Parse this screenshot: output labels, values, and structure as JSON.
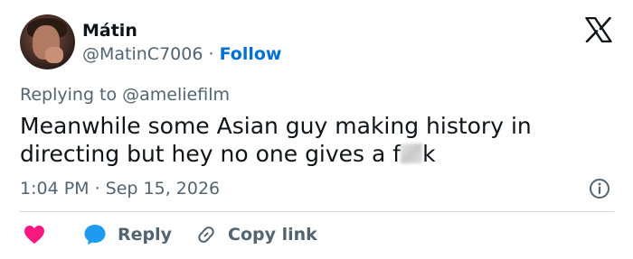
{
  "author": {
    "display_name": "Mátin",
    "handle": "@MatinC7006",
    "separator": "·",
    "follow_label": "Follow"
  },
  "reply_context": {
    "text": "Replying to @ameliefilm"
  },
  "tweet": {
    "text_before_censor": "Meanwhile some Asian guy making history in directing but hey no one gives a f",
    "text_after_censor": "k"
  },
  "meta": {
    "timestamp": "1:04 PM · Sep 15, 2026"
  },
  "actions": {
    "reply_label": "Reply",
    "copy_link_label": "Copy link"
  },
  "icons": {
    "logo": "x-logo-icon",
    "info": "info-icon",
    "like": "heart-icon",
    "reply": "speech-bubble-icon",
    "copy": "link-icon"
  },
  "colors": {
    "text": "#0f1419",
    "secondary": "#536471",
    "follow": "#006fd6",
    "like": "#f91880",
    "reply": "#1d9bf0",
    "divider": "#cfd9de"
  }
}
